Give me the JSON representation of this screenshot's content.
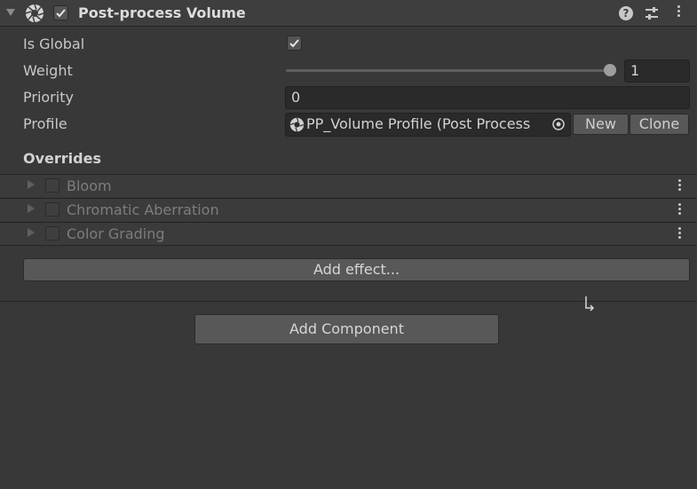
{
  "component": {
    "title": "Post-process Volume",
    "enabled": true
  },
  "properties": {
    "is_global_label": "Is Global",
    "is_global_checked": true,
    "weight_label": "Weight",
    "weight_value": "1",
    "weight_fraction": 1.0,
    "priority_label": "Priority",
    "priority_value": "0",
    "profile_label": "Profile",
    "profile_value": "PP_Volume Profile (Post Process",
    "new_label": "New",
    "clone_label": "Clone"
  },
  "overrides": {
    "title": "Overrides",
    "items": [
      {
        "label": "Bloom",
        "enabled": false
      },
      {
        "label": "Chromatic Aberration",
        "enabled": false
      },
      {
        "label": "Color Grading",
        "enabled": false
      }
    ],
    "add_effect_label": "Add effect..."
  },
  "footer": {
    "add_component_label": "Add Component"
  },
  "icons": {
    "fold": "foldout-arrow-icon",
    "component": "aperture-icon",
    "help": "help-icon",
    "presets": "presets-icon",
    "menu": "kebab-menu-icon",
    "picker": "object-picker-icon"
  },
  "colors": {
    "background": "#383838",
    "header": "#3e3e3e",
    "field": "#2a2a2a",
    "button": "#585858",
    "text": "#c8c8c8",
    "disabled_text": "#7d7d7d"
  }
}
